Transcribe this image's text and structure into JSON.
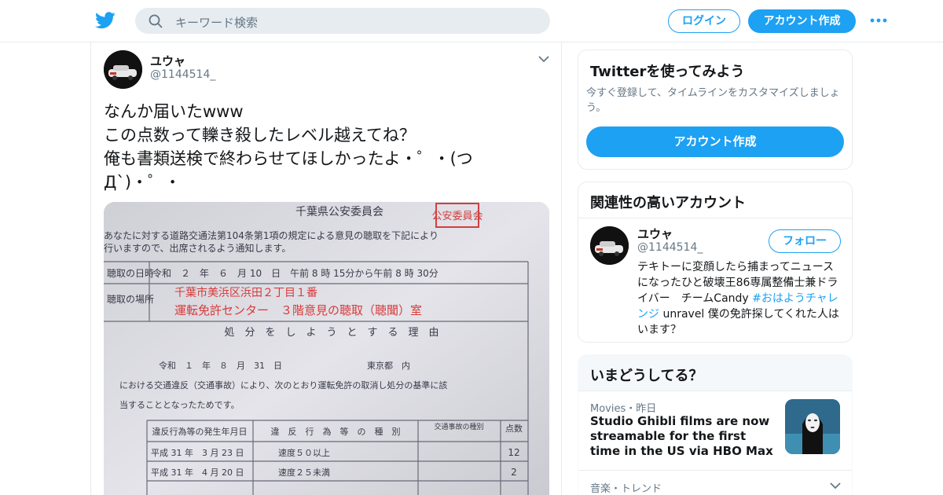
{
  "header": {
    "search_placeholder": "キーワード検索",
    "login_label": "ログイン",
    "signup_label": "アカウント作成",
    "accent_color": "#1da1f2"
  },
  "tweet": {
    "author_name": "ユウャ",
    "author_handle": "@1144514_",
    "text": "なんか届いたwww\nこの点数って轢き殺したレベル越えてね？\n俺も書類送検で終わらせてほしかったよ・゜・(つД`)・゜・",
    "photo": {
      "header": "千葉県公安委員会",
      "stamp": "公安委員会",
      "line1": "あなたに対する道路交通法第104条第1項の規定による意見の聴取を下記により",
      "line2": "行いますので、出席されるよう通知します。",
      "date_label": "聴取の日時",
      "date_value": "令和　２　年　６　月 10　日　午前 8 時 15分から午前 8 時 30分",
      "place_label": "聴取の場所",
      "place_value1": "千葉市美浜区浜田２丁目１番",
      "place_value2": "運転免許センター　３階意見の聴取（聴聞）室",
      "reason_header": "処　分　を　し　よ　う　と　す　る　理　由",
      "reason_date": "令和　１　年　８　月　31　日",
      "reason_place": "東京都　内",
      "reason_text1": "における交通違反（交通事故）により、次のとおり運転免許の取消し処分の基準に該",
      "reason_text2": "当することとなったためです。",
      "table_col1": "違反行為等の発生年月日",
      "table_col2": "違　反　行　為　等　の　種　別",
      "table_col3": "交通事故の種別",
      "table_col4": "点数",
      "row1_date": "平成 31 年　3 月 23 日",
      "row1_kind": "速度５０以上",
      "row1_points": "12",
      "row2_date": "平成 31 年　4 月 20 日",
      "row2_kind": "速度２５未満",
      "row2_points": "2"
    }
  },
  "sidebar": {
    "signup_card": {
      "title": "Twitterを使ってみよう",
      "description": "今すぐ登録して、タイムラインをカスタマイズしましょう。",
      "cta": "アカウント作成"
    },
    "related": {
      "title": "関連性の高いアカウント",
      "name": "ユウャ",
      "handle": "@1144514_",
      "follow_label": "フォロー",
      "bio_before": "テキトーに変顔したら捕まってニュースになったひと破壊王86専属整備士兼ドライバー　チームCandy ",
      "bio_hashtag": "#おはようチャレンジ",
      "bio_after": " unravel 僕の免許探してくれた人はいます？"
    },
    "trends": {
      "title": "いまどうしてる？",
      "item1_meta": "Movies・昨日",
      "item1_headline": "Studio Ghibli films are now streamable for the first time in the US via HBO Max",
      "item2_meta": "音楽・トレンド"
    }
  }
}
